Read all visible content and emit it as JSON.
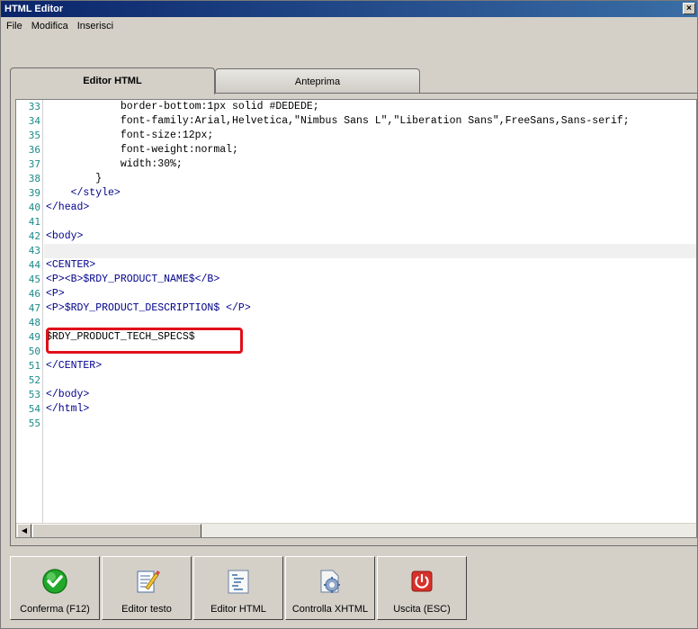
{
  "window": {
    "title": "HTML Editor",
    "close_glyph": "×"
  },
  "menu": {
    "items": [
      "File",
      "Modifica",
      "Inserisci"
    ]
  },
  "tabs": [
    {
      "label": "Editor HTML"
    },
    {
      "label": "Anteprima"
    }
  ],
  "editor": {
    "current_line": 43,
    "highlighted_line": 49,
    "lines": [
      {
        "n": "33",
        "text": "            border-bottom:1px solid #DEDEDE;"
      },
      {
        "n": "34",
        "text": "            font-family:Arial,Helvetica,\"Nimbus Sans L\",\"Liberation Sans\",FreeSans,Sans-serif;"
      },
      {
        "n": "35",
        "text": "            font-size:12px;"
      },
      {
        "n": "36",
        "text": "            font-weight:normal;"
      },
      {
        "n": "37",
        "text": "            width:30%;"
      },
      {
        "n": "38",
        "text": "        }"
      },
      {
        "n": "39",
        "text": "    </style>"
      },
      {
        "n": "40",
        "text": "</head>"
      },
      {
        "n": "41",
        "text": ""
      },
      {
        "n": "42",
        "text": "<body>"
      },
      {
        "n": "43",
        "text": ""
      },
      {
        "n": "44",
        "text": "<CENTER>"
      },
      {
        "n": "45",
        "text": "<P><B>$RDY_PRODUCT_NAME$</B>"
      },
      {
        "n": "46",
        "text": "<P>"
      },
      {
        "n": "47",
        "text": "<P>$RDY_PRODUCT_DESCRIPTION$ </P>"
      },
      {
        "n": "48",
        "text": ""
      },
      {
        "n": "49",
        "text": "$RDY_PRODUCT_TECH_SPECS$"
      },
      {
        "n": "50",
        "text": ""
      },
      {
        "n": "51",
        "text": "</CENTER>"
      },
      {
        "n": "52",
        "text": ""
      },
      {
        "n": "53",
        "text": "</body>"
      },
      {
        "n": "54",
        "text": "</html>"
      },
      {
        "n": "55",
        "text": ""
      }
    ]
  },
  "toolbar": {
    "buttons": [
      {
        "label": "Conferma (F12)",
        "icon": "checkmark-icon"
      },
      {
        "label": "Editor testo",
        "icon": "text-editor-icon"
      },
      {
        "label": "Editor HTML",
        "icon": "html-editor-icon"
      },
      {
        "label": "Controlla XHTML",
        "icon": "validate-xhtml-icon"
      },
      {
        "label": "Uscita (ESC)",
        "icon": "exit-icon"
      }
    ]
  },
  "colors": {
    "titlebar": "#0a246a",
    "line_numbers": "#1a8a8a",
    "tag": "#00008b",
    "highlight_box": "#e0101a",
    "confirm_green": "#22a82a",
    "exit_red": "#d8302a"
  }
}
